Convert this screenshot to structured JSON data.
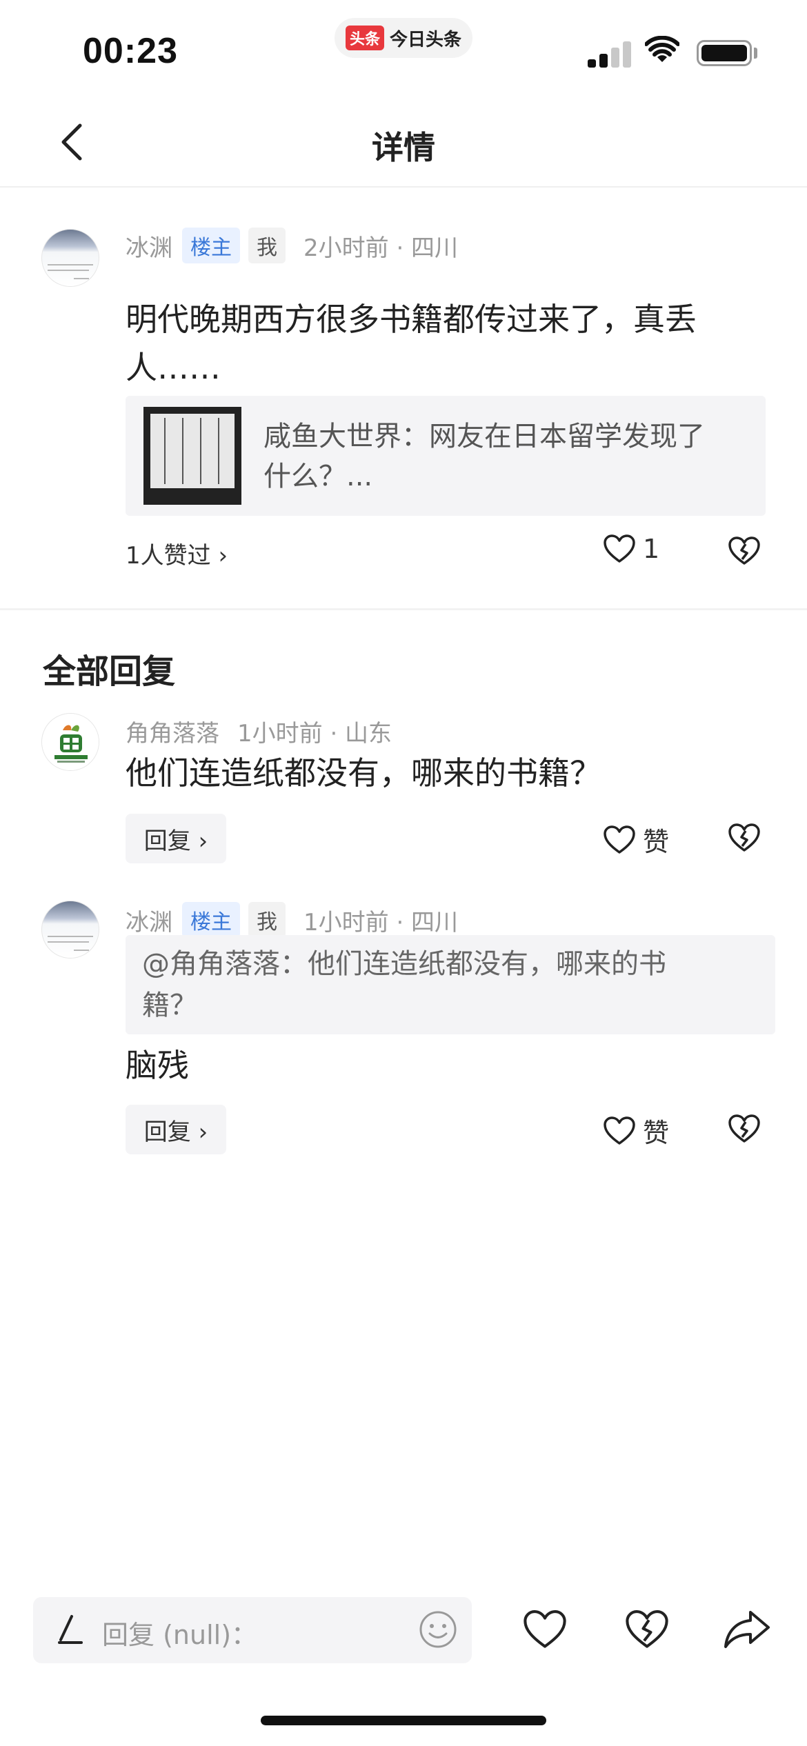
{
  "status_bar": {
    "time": "00:23",
    "app_logo": "头条",
    "app_name": "今日头条"
  },
  "nav": {
    "title": "详情",
    "back_icon": "chevron-left-icon"
  },
  "main_comment": {
    "username": "冰渊",
    "host_badge": "楼主",
    "me_badge": "我",
    "time_location": "2小时前 · 四川",
    "text_line1": "明代晚期西方很多书籍都传过来了，真丢",
    "text_line2": "人……",
    "card": {
      "line1": "咸鱼大世界：网友在日本留学发现了",
      "line2": "什么？..."
    },
    "likes_summary": "1人赞过 ›",
    "like_count": "1"
  },
  "section_title": "全部回复",
  "replies": [
    {
      "username": "角角落落",
      "time_location": "1小时前 · 山东",
      "text": "他们连造纸都没有，哪来的书籍？",
      "reply_label": "回复 ›",
      "like_label": "赞"
    },
    {
      "username": "冰渊",
      "host_badge": "楼主",
      "me_badge": "我",
      "time_location": "1小时前 · 四川",
      "quote_line1": "@角角落落：他们连造纸都没有，哪来的书",
      "quote_line2": "籍？",
      "text": "脑残",
      "reply_label": "回复 ›",
      "like_label": "赞"
    }
  ],
  "bottom_bar": {
    "placeholder": "回复 (null)："
  },
  "colors": {
    "host_badge": "#3a78d8",
    "logo": "#e8383d"
  }
}
